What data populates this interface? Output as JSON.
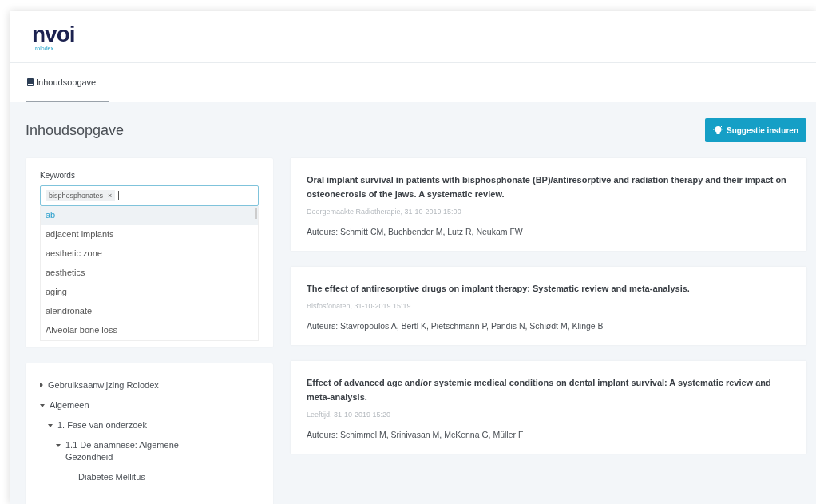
{
  "logo": {
    "name": "nvoi",
    "subtitle": "rolodex"
  },
  "tabs": [
    {
      "label": "Inhoudsopgave",
      "selected": true
    }
  ],
  "page_title": "Inhoudsopgave",
  "suggest_button": "Suggestie insturen",
  "keywords": {
    "label": "Keywords",
    "tags": [
      "bisphosphonates"
    ],
    "remove": "×",
    "options": [
      {
        "label": "ab",
        "selected": true
      },
      {
        "label": "adjacent implants",
        "selected": false
      },
      {
        "label": "aesthetic zone",
        "selected": false
      },
      {
        "label": "aesthetics",
        "selected": false
      },
      {
        "label": "aging",
        "selected": false
      },
      {
        "label": "alendronate",
        "selected": false
      },
      {
        "label": "Alveolar bone loss",
        "selected": false
      }
    ]
  },
  "tree": [
    {
      "label": "Gebruiksaanwijzing Rolodex",
      "expanded": false
    },
    {
      "label": "Algemeen",
      "expanded": true,
      "children": [
        {
          "label": "1. Fase van onderzoek",
          "expanded": true,
          "children": [
            {
              "label": "1.1 De anamnese: Algemene Gezondheid",
              "expanded": true,
              "children": [
                {
                  "label": "Diabetes Mellitus"
                }
              ]
            }
          ]
        }
      ]
    }
  ],
  "articles": [
    {
      "title": "Oral implant survival in patients with bisphosphonate (BP)/antiresorptive and radiation therapy and their impact on osteonecrosis of the jaws. A systematic review.",
      "meta": "Doorgemaakte Radiotherapie, 31-10-2019 15:00",
      "authors": "Auteurs: Schmitt CM, Buchbender M, Lutz R, Neukam FW"
    },
    {
      "title": "The effect of antiresorptive drugs on implant therapy: Systematic review and meta-analysis.",
      "meta": "Bisfosfonaten, 31-10-2019 15:19",
      "authors": "Auteurs: Stavropoulos A, Bertl K, Pietschmann P, Pandis N, Schiødt M, Klinge B"
    },
    {
      "title": "Effect of advanced age and/or systemic medical conditions on dental implant survival: A systematic review and meta-analysis.",
      "meta": "Leeftijd, 31-10-2019 15:20",
      "authors": "Auteurs: Schimmel M, Srinivasan M, McKenna G, Müller F"
    }
  ]
}
